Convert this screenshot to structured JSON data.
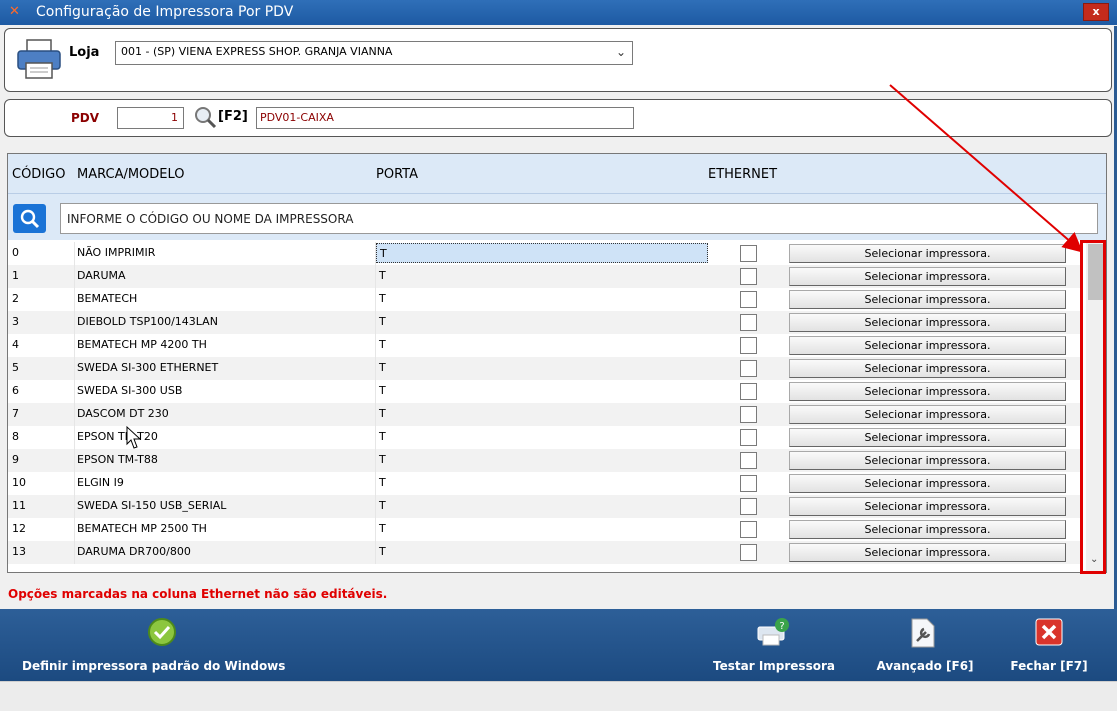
{
  "window": {
    "title": "Configuração de Impressora Por PDV",
    "close": "x"
  },
  "loja": {
    "label": "Loja",
    "selected": "001 - (SP) VIENA EXPRESS  SHOP. GRANJA VIANNA"
  },
  "pdv": {
    "label": "PDV",
    "number": "1",
    "shortcut": "[F2]",
    "name": "PDV01-CAIXA"
  },
  "grid": {
    "headers": {
      "codigo": "CÓDIGO",
      "marca": "MARCA/MODELO",
      "porta": "PORTA",
      "ethernet": "ETHERNET"
    },
    "search_text": "INFORME O CÓDIGO OU NOME DA IMPRESSORA",
    "button_label": "Selecionar impressora.",
    "rows": [
      {
        "code": "0",
        "model": "NÃO IMPRIMIR",
        "port": "T"
      },
      {
        "code": "1",
        "model": "DARUMA",
        "port": "T"
      },
      {
        "code": "2",
        "model": "BEMATECH",
        "port": "T"
      },
      {
        "code": "3",
        "model": "DIEBOLD TSP100/143LAN",
        "port": "T"
      },
      {
        "code": "4",
        "model": "BEMATECH MP 4200 TH",
        "port": "T"
      },
      {
        "code": "5",
        "model": "SWEDA SI-300 ETHERNET",
        "port": "T"
      },
      {
        "code": "6",
        "model": "SWEDA SI-300 USB",
        "port": "T"
      },
      {
        "code": "7",
        "model": "DASCOM DT 230",
        "port": "T"
      },
      {
        "code": "8",
        "model": "EPSON TM-T20",
        "port": "T"
      },
      {
        "code": "9",
        "model": "EPSON TM-T88",
        "port": "T"
      },
      {
        "code": "10",
        "model": "ELGIN I9",
        "port": "T"
      },
      {
        "code": "11",
        "model": "SWEDA SI-150 USB_SERIAL",
        "port": "T"
      },
      {
        "code": "12",
        "model": "BEMATECH MP 2500 TH",
        "port": "T"
      },
      {
        "code": "13",
        "model": "DARUMA DR700/800",
        "port": "T"
      }
    ]
  },
  "warning": "Opções marcadas na coluna Ethernet não são editáveis.",
  "toolbar": {
    "default_windows": "Definir impressora padrão do Windows",
    "test": "Testar Impressora",
    "advanced": "Avançado [F6]",
    "close": "Fechar [F7]"
  },
  "colors": {
    "titlebar": "#1d5aa3",
    "toolbar": "#1c4a80",
    "warning": "#e00000",
    "annotation": "#e00000"
  }
}
